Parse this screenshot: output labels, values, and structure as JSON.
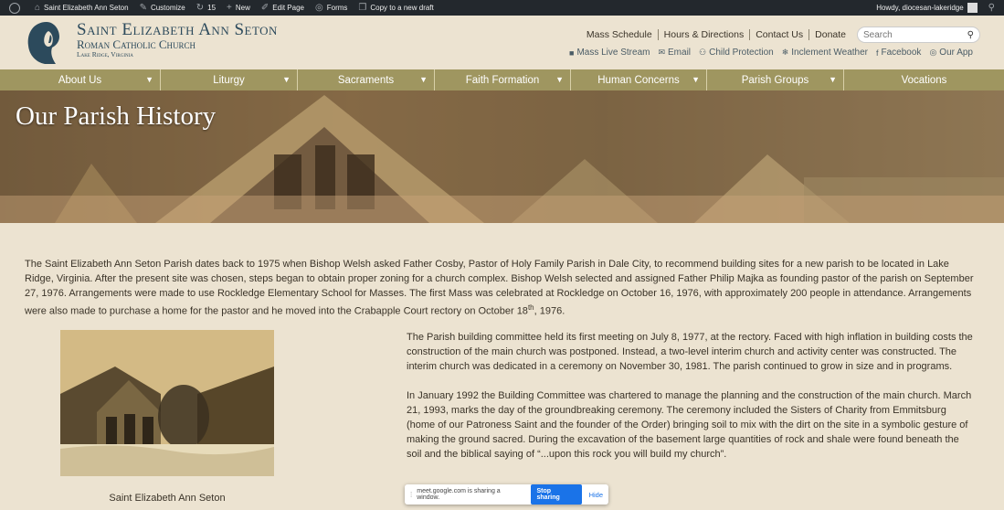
{
  "adminbar": {
    "items": [
      {
        "icon": "home-icon",
        "label": "Saint Elizabeth Ann Seton"
      },
      {
        "icon": "customize-icon",
        "label": "Customize"
      },
      {
        "icon": "updates-icon",
        "label": "15"
      },
      {
        "icon": "plus-icon",
        "label": "New"
      },
      {
        "icon": "edit-icon",
        "label": "Edit Page"
      },
      {
        "icon": "forms-icon",
        "label": "Forms"
      },
      {
        "icon": "copy-icon",
        "label": "Copy to a new draft"
      }
    ],
    "greeting": "Howdy, diocesan-lakeridge"
  },
  "header": {
    "title_line1": "Saint Elizabeth Ann Seton",
    "title_line2": "Roman Catholic Church",
    "title_line3": "Lake Ridge, Virginia",
    "toplinks": [
      "Mass Schedule",
      "Hours & Directions",
      "Contact Us",
      "Donate"
    ],
    "search_placeholder": "Search",
    "sublinks": [
      {
        "icon": "video-icon",
        "label": "Mass Live Stream"
      },
      {
        "icon": "email-icon",
        "label": "Email"
      },
      {
        "icon": "child-protection-icon",
        "label": "Child Protection"
      },
      {
        "icon": "snowflake-icon",
        "label": "Inclement Weather"
      },
      {
        "icon": "facebook-icon",
        "label": "Facebook"
      },
      {
        "icon": "app-icon",
        "label": "Our App"
      }
    ]
  },
  "nav": {
    "items": [
      {
        "label": "About Us",
        "dropdown": true
      },
      {
        "label": "Liturgy",
        "dropdown": true
      },
      {
        "label": "Sacraments",
        "dropdown": true
      },
      {
        "label": "Faith Formation",
        "dropdown": true
      },
      {
        "label": "Human Concerns",
        "dropdown": true
      },
      {
        "label": "Parish Groups",
        "dropdown": true
      },
      {
        "label": "Vocations",
        "dropdown": false
      }
    ]
  },
  "hero": {
    "title": "Our Parish History"
  },
  "content": {
    "intro_before_sup": "The Saint Elizabeth Ann Seton Parish dates back to 1975 when Bishop Welsh asked Father Cosby, Pastor of Holy Family Parish in Dale City, to recommend building sites for a new parish to be located in Lake Ridge, Virginia. After the present site was chosen, steps began to obtain proper zoning for a church complex. Bishop Welsh selected and assigned Father Philip Majka as founding pastor of the parish on September 27, 1976. Arrangements were made to use Rockledge Elementary School for Masses. The first Mass was celebrated at Rockledge on October 16, 1976, with approximately 200 people in attendance. Arrangements were also made to purchase a home for the pastor and he moved into the Crabapple Court rectory on October 18",
    "intro_sup": "th",
    "intro_after_sup": ", 1976.",
    "photo_caption": "Saint Elizabeth Ann Seton",
    "paragraph2": "The Parish building committee held its first meeting on July 8, 1977, at the rectory. Faced with high inflation in building costs the construction of the main church was postponed. Instead, a two-level interim church and activity center was constructed. The interim church was dedicated in a ceremony on November 30, 1981. The parish continued to grow in size and in programs.",
    "paragraph3": "In January 1992 the Building Committee was chartered to manage the planning and the construction of the main church. March 21, 1993, marks the day of the groundbreaking ceremony. The ceremony included the Sisters of Charity from Emmitsburg (home of our Patroness Saint and the founder of the Order) bringing soil to mix with the dirt on the site in a symbolic gesture of making the ground sacred. During the excavation of the basement large quantities of rock and shale were found beneath the soil and the biblical saying of “...upon this rock you will build my church”."
  },
  "sharebar": {
    "message": "meet.google.com is sharing a window.",
    "stop_label": "Stop sharing",
    "hide_label": "Hide"
  },
  "colors": {
    "background": "#ece3d1",
    "nav": "#9f9660",
    "title": "#2c4a5c",
    "adminbar": "#23282d",
    "stop_button": "#1a73e8"
  }
}
